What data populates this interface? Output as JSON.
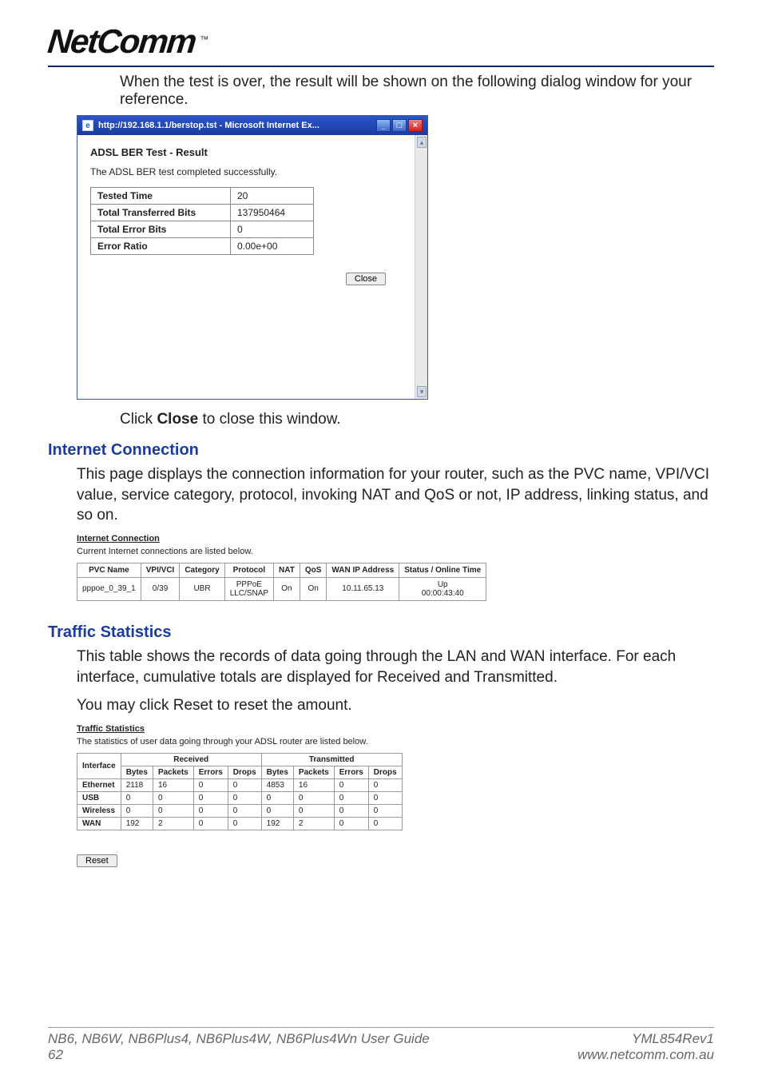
{
  "logo": {
    "text": "NetComm",
    "tm": "™"
  },
  "intro": "When the test is over, the result will be shown on the following dialog window for your reference.",
  "window": {
    "title": "http://192.168.1.1/berstop.tst - Microsoft Internet Ex...",
    "ber_title": "ADSL BER Test - Result",
    "ber_msg": "The ADSL BER test completed successfully.",
    "rows": [
      {
        "label": "Tested Time",
        "value": "20"
      },
      {
        "label": "Total Transferred Bits",
        "value": "137950464"
      },
      {
        "label": "Total Error Bits",
        "value": "0"
      },
      {
        "label": "Error Ratio",
        "value": "0.00e+00"
      }
    ],
    "close_label": "Close"
  },
  "click_close_pre": "Click ",
  "click_close_bold": "Close",
  "click_close_post": " to close this window.",
  "internet": {
    "heading": "Internet Connection",
    "desc": "This page displays the connection information for your router, such as the PVC name, VPI/VCI value, service category, protocol, invoking NAT and QoS or not, IP address, linking status, and so on.",
    "sub_title": "Internet Connection",
    "sub_desc": "Current Internet connections are listed below.",
    "headers": [
      "PVC Name",
      "VPI/VCI",
      "Category",
      "Protocol",
      "NAT",
      "QoS",
      "WAN IP Address",
      "Status / Online Time"
    ],
    "row": {
      "pvc": "pppoe_0_39_1",
      "vpivci": "0/39",
      "category": "UBR",
      "protocol_l1": "PPPoE",
      "protocol_l2": "LLC/SNAP",
      "nat": "On",
      "qos": "On",
      "ip": "10.11.65.13",
      "status_l1": "Up",
      "status_l2": "00:00:43:40"
    }
  },
  "traffic": {
    "heading": "Traffic Statistics",
    "desc1": "This table shows the records of data going through the LAN and WAN interface. For each interface, cumulative totals are displayed for Received and Transmitted.",
    "desc2": "You may click Reset to reset the amount.",
    "sub_title": "Traffic Statistics",
    "sub_desc": "The statistics of user data going through your ADSL router are listed below.",
    "h_interface": "Interface",
    "h_received": "Received",
    "h_transmitted": "Transmitted",
    "cols": [
      "Bytes",
      "Packets",
      "Errors",
      "Drops"
    ],
    "rows": [
      {
        "iface": "Ethernet",
        "r": [
          "2118",
          "16",
          "0",
          "0"
        ],
        "t": [
          "4853",
          "16",
          "0",
          "0"
        ]
      },
      {
        "iface": "USB",
        "r": [
          "0",
          "0",
          "0",
          "0"
        ],
        "t": [
          "0",
          "0",
          "0",
          "0"
        ]
      },
      {
        "iface": "Wireless",
        "r": [
          "0",
          "0",
          "0",
          "0"
        ],
        "t": [
          "0",
          "0",
          "0",
          "0"
        ]
      },
      {
        "iface": "WAN",
        "r": [
          "192",
          "2",
          "0",
          "0"
        ],
        "t": [
          "192",
          "2",
          "0",
          "0"
        ]
      }
    ],
    "reset_label": "Reset"
  },
  "footer": {
    "left1": "NB6, NB6W, NB6Plus4, NB6Plus4W, NB6Plus4Wn User Guide",
    "left2": "62",
    "right1": "YML854Rev1",
    "right2": "www.netcomm.com.au"
  }
}
